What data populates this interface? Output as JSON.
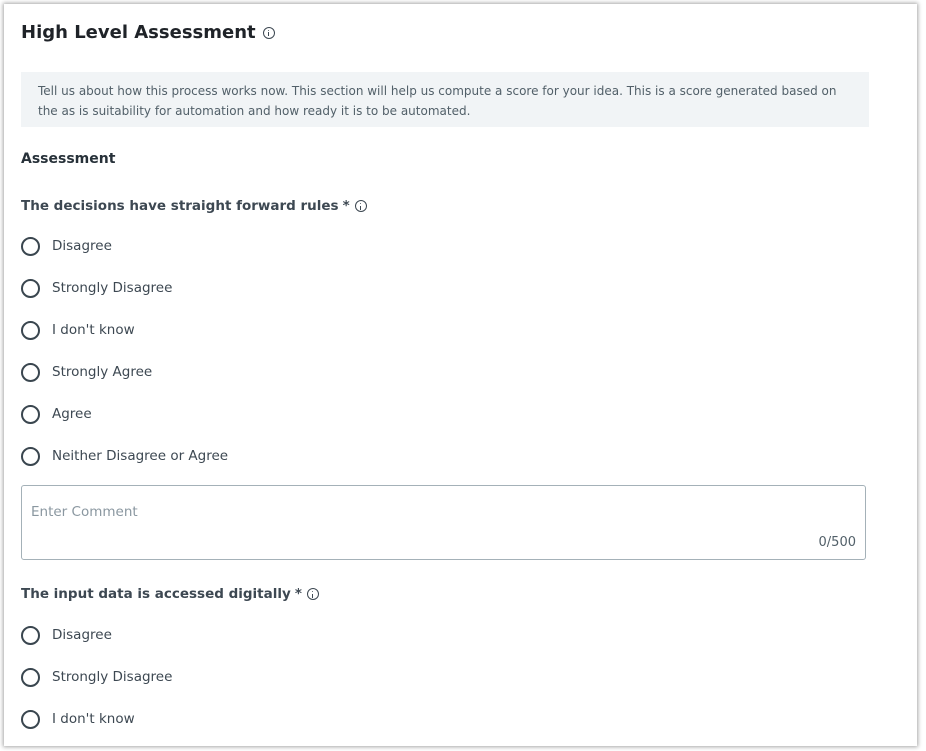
{
  "header": {
    "title": "High Level Assessment"
  },
  "info_text": "Tell us about how this process works now. This section will help us compute a score for your idea. This is a score generated based on the as is suitability for automation and how ready it is to be automated.",
  "section_heading": "Assessment",
  "questions": [
    {
      "label": "The decisions have straight forward rules",
      "required_mark": "*",
      "options": [
        "Disagree",
        "Strongly Disagree",
        "I don't know",
        "Strongly Agree",
        "Agree",
        "Neither Disagree or Agree"
      ],
      "comment": {
        "placeholder": "Enter Comment",
        "value": "",
        "counter": "0/500"
      }
    },
    {
      "label": "The input data is accessed digitally",
      "required_mark": "*",
      "options": [
        "Disagree",
        "Strongly Disagree",
        "I don't know"
      ]
    }
  ],
  "icons": {
    "info": "info-circle-icon",
    "radio": "radio-unchecked"
  }
}
